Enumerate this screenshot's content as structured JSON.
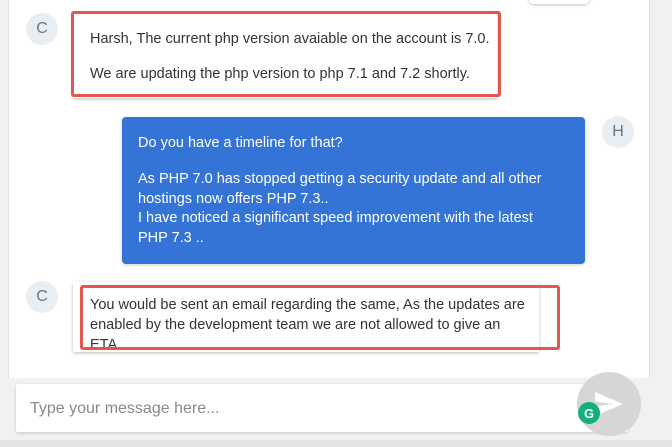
{
  "messages": [
    {
      "sender": "agent",
      "avatar": "C",
      "lines": [
        "Harsh, The current php version avaiable on the account is 7.0.",
        "We are updating the php version to php 7.1 and 7.2 shortly."
      ]
    },
    {
      "sender": "user",
      "avatar": "H",
      "paragraphs": [
        "Do you have a timeline for that?",
        "As PHP 7.0 has stopped getting a security update and all other hostings now offers PHP 7.3..",
        "I have noticed a significant speed improvement with the latest PHP 7.3 .."
      ]
    },
    {
      "sender": "agent",
      "avatar": "C",
      "text": "You would be sent an email regarding the same, As the updates are enabled by the development team we are not allowed to give an ETA."
    }
  ],
  "composer": {
    "placeholder": "Type your message here...",
    "send_icon": "paper-plane-icon",
    "badge_icon": "grammarly-icon",
    "badge_letter": "G"
  },
  "colors": {
    "user_bubble": "#3374d6",
    "highlight": "#e25650",
    "grammarly": "#15b07a"
  }
}
